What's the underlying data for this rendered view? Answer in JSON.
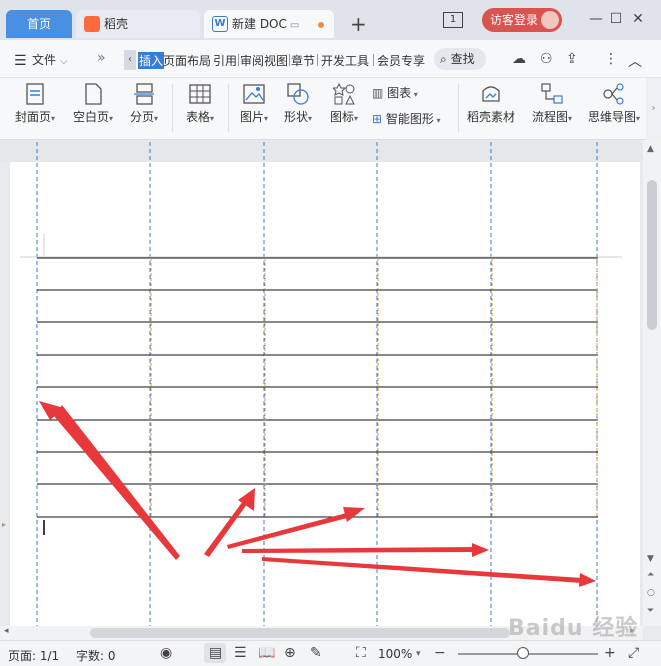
{
  "tabs": {
    "home": "首页",
    "daoke": "稻壳",
    "doc": "新建 DOC",
    "window_count": "1",
    "login": "访客登录"
  },
  "menu": {
    "file": "文件",
    "items": [
      "插入",
      "页面布局",
      "引用",
      "审阅",
      "视图",
      "章节",
      "开发工具",
      "会员专享"
    ],
    "search": "查找"
  },
  "ribbon": {
    "cover": "封面页",
    "blank": "空白页",
    "pagebreak": "分页",
    "table": "表格",
    "picture": "图片",
    "shape": "形状",
    "icon": "图标",
    "chart": "图表",
    "smartart": "智能图形",
    "daoke_material": "稻壳素材",
    "flowchart": "流程图",
    "mindmap": "思维导图"
  },
  "status": {
    "page": "页面: 1/1",
    "words": "字数: 0",
    "zoom": "100%"
  },
  "watermark": "Baidu 经验",
  "colors": {
    "accent": "#3a7bd5",
    "home_tab": "#4a90e2",
    "login": "#d9534f",
    "arrow": "#e8383b",
    "column_guide": "#3a7bd5"
  }
}
